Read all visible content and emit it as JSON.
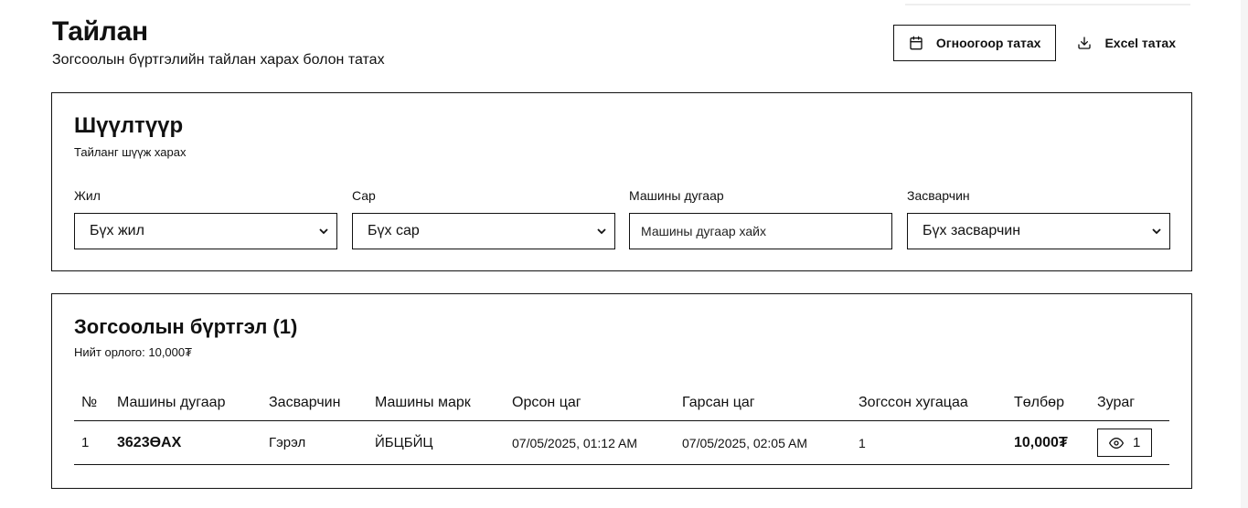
{
  "header": {
    "title": "Тайлан",
    "subtitle": "Зогсоолын бүртгэлийн тайлан харах болон татах"
  },
  "actions": {
    "date_download_label": "Огноогоор татах",
    "excel_download_label": "Excel татах"
  },
  "filter": {
    "title": "Шүүлтүүр",
    "description": "Тайланг шүүж харах",
    "fields": [
      {
        "label": "Жил",
        "value": "Бүх жил"
      },
      {
        "label": "Сар",
        "value": "Бүх сар"
      },
      {
        "label": "Машины дугаар",
        "placeholder": "Машины дугаар хайх"
      },
      {
        "label": "Засварчин",
        "value": "Бүх засварчин"
      }
    ]
  },
  "records": {
    "title": "Зогсоолын бүртгэл (1)",
    "total_income": "Нийт орлого: 10,000₮",
    "columns": [
      "№",
      "Машины дугаар",
      "Засварчин",
      "Машины марк",
      "Орсон цаг",
      "Гарсан цаг",
      "Зогссон хугацаа",
      "Төлбөр",
      "Зураг"
    ],
    "rows": [
      {
        "no": "1",
        "plate": "3623ӨАХ",
        "mechanic": "Гэрэл",
        "brand": "ЙБЦБЙЦ",
        "entry_time": "07/05/2025, 01:12 AM",
        "exit_time": "07/05/2025, 02:05 AM",
        "duration": "1",
        "fee": "10,000₮",
        "image_count": "1"
      }
    ]
  },
  "icons": {
    "calendar": "calendar-icon",
    "download": "download-icon",
    "chevron": "chevron-down-icon",
    "eye": "eye-icon"
  }
}
